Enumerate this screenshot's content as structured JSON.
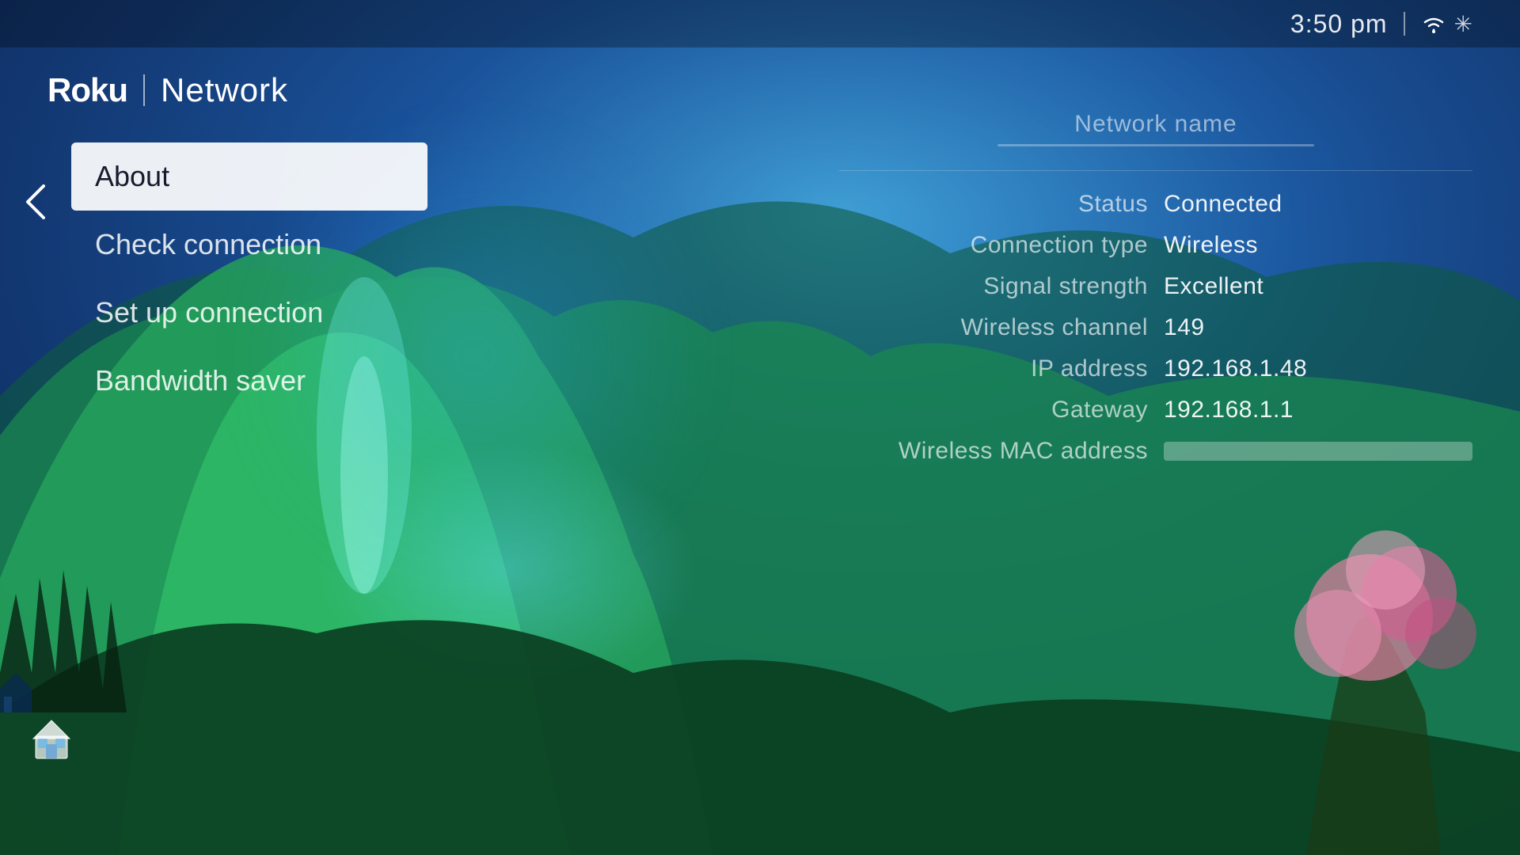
{
  "header": {
    "logo": "Roku",
    "page_title": "Network",
    "time": "3:50 pm"
  },
  "menu": {
    "items": [
      {
        "label": "About",
        "active": true
      },
      {
        "label": "Check connection",
        "active": false
      },
      {
        "label": "Set up connection",
        "active": false
      },
      {
        "label": "Bandwidth saver",
        "active": false
      }
    ],
    "back_label": "<"
  },
  "network_info": {
    "network_name_label": "Network name",
    "rows": [
      {
        "label": "Status",
        "value": "Connected",
        "blurred": false
      },
      {
        "label": "Connection type",
        "value": "Wireless",
        "blurred": false
      },
      {
        "label": "Signal strength",
        "value": "Excellent",
        "blurred": false
      },
      {
        "label": "Wireless channel",
        "value": "149",
        "blurred": false
      },
      {
        "label": "IP address",
        "value": "192.168.1.48",
        "blurred": false
      },
      {
        "label": "Gateway",
        "value": "192.168.1.1",
        "blurred": false
      },
      {
        "label": "Wireless MAC address",
        "value": "",
        "blurred": true
      }
    ]
  }
}
